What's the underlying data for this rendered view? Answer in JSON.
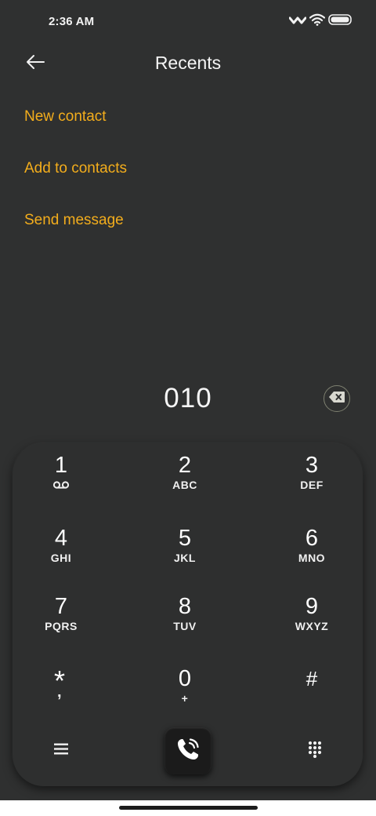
{
  "status_bar": {
    "time": "2:36 AM",
    "icons": [
      "signal-icon",
      "wifi-icon",
      "battery-icon"
    ]
  },
  "header": {
    "title": "Recents",
    "back_icon": "back-arrow-icon"
  },
  "menu": {
    "items": [
      {
        "label": "New contact"
      },
      {
        "label": "Add to contacts"
      },
      {
        "label": "Send message"
      }
    ]
  },
  "dial": {
    "number": "010",
    "backspace_icon": "backspace-icon"
  },
  "keypad": {
    "keys": [
      {
        "digit": "1",
        "letters": "",
        "icon": "voicemail-icon"
      },
      {
        "digit": "2",
        "letters": "ABC"
      },
      {
        "digit": "3",
        "letters": "DEF"
      },
      {
        "digit": "4",
        "letters": "GHI"
      },
      {
        "digit": "5",
        "letters": "JKL"
      },
      {
        "digit": "6",
        "letters": "MNO"
      },
      {
        "digit": "7",
        "letters": "PQRS"
      },
      {
        "digit": "8",
        "letters": "TUV"
      },
      {
        "digit": "9",
        "letters": "WXYZ"
      },
      {
        "digit": "*",
        "letters": ","
      },
      {
        "digit": "0",
        "letters": "+"
      },
      {
        "digit": "#",
        "letters": ""
      }
    ],
    "menu_icon": "hamburger-menu-icon",
    "call_icon": "phone-call-icon",
    "dialpad_icon": "dialpad-grid-icon"
  },
  "colors": {
    "background": "#2f3030",
    "accent": "#f3ad1c"
  }
}
